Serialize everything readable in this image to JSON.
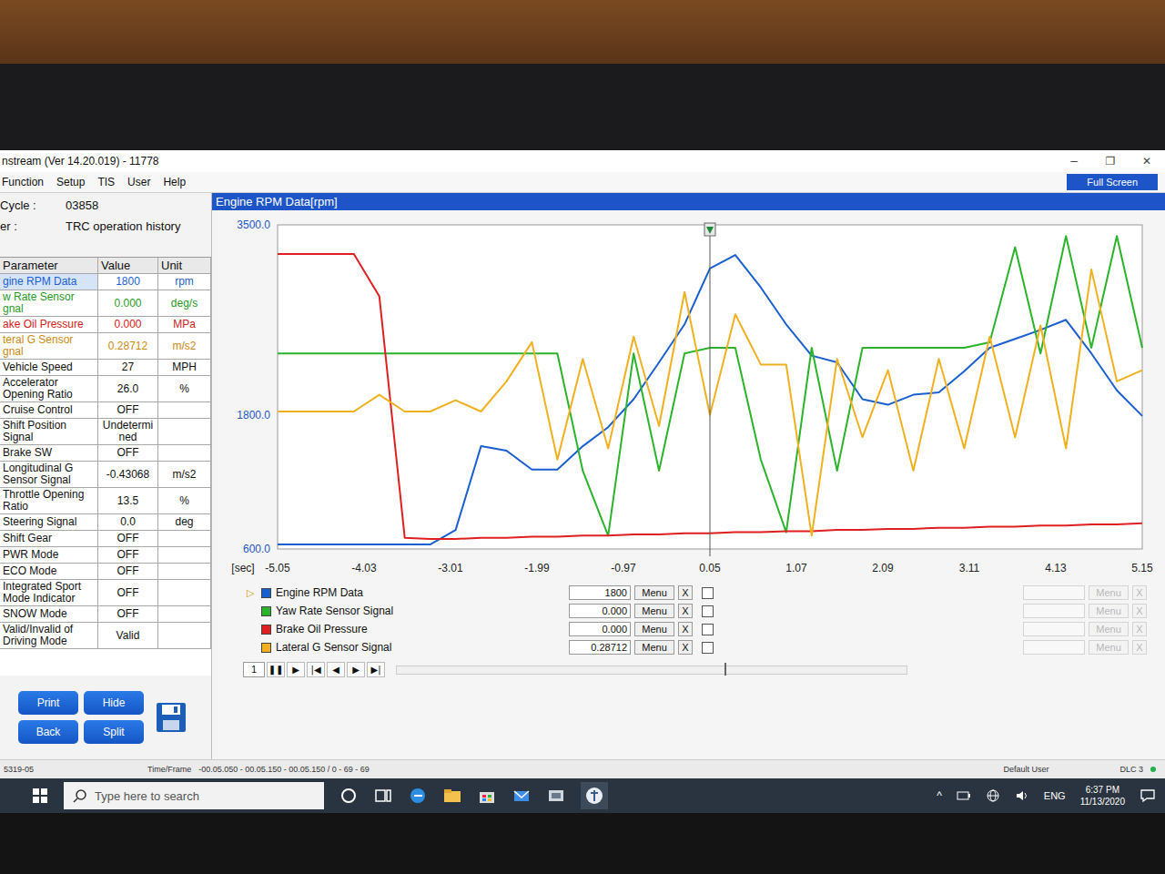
{
  "window": {
    "title": "nstream (Ver 14.20.019) - 11778",
    "controls": [
      "−",
      "❐",
      "✕"
    ]
  },
  "menu": [
    "Function",
    "Setup",
    "TIS",
    "User",
    "Help"
  ],
  "full_screen": "Full Screen",
  "info": [
    {
      "label": "Cycle :",
      "value": "03858"
    },
    {
      "label": "er :",
      "value": "TRC operation history"
    }
  ],
  "table": {
    "columns": [
      "Parameter",
      "Value",
      "Unit"
    ],
    "rows": [
      {
        "parameter": "gine RPM Data",
        "value": "1800",
        "unit": "rpm",
        "color": "#1a5fd0",
        "selected": true
      },
      {
        "parameter": "w Rate Sensor gnal",
        "value": "0.000",
        "unit": "deg/s",
        "color": "#1f9a1f",
        "selected": false
      },
      {
        "parameter": "ake Oil Pressure",
        "value": "0.000",
        "unit": "MPa",
        "color": "#d42020",
        "selected": false
      },
      {
        "parameter": "teral G Sensor gnal",
        "value": "0.28712",
        "unit": "m/s2",
        "color": "#c98a10",
        "selected": false
      },
      {
        "parameter": "Vehicle Speed",
        "value": "27",
        "unit": "MPH",
        "selected": false
      },
      {
        "parameter": "Accelerator Opening Ratio",
        "value": "26.0",
        "unit": "%",
        "selected": false
      },
      {
        "parameter": "Cruise Control",
        "value": "OFF",
        "unit": "",
        "selected": false
      },
      {
        "parameter": "Shift Position Signal",
        "value": "Undetermined",
        "unit": "",
        "selected": false
      },
      {
        "parameter": "Brake SW",
        "value": "OFF",
        "unit": "",
        "selected": false
      },
      {
        "parameter": "Longitudinal G Sensor Signal",
        "value": "-0.43068",
        "unit": "m/s2",
        "selected": false
      },
      {
        "parameter": "Throttle Opening Ratio",
        "value": "13.5",
        "unit": "%",
        "selected": false
      },
      {
        "parameter": "Steering Signal",
        "value": "0.0",
        "unit": "deg",
        "selected": false
      },
      {
        "parameter": "Shift Gear",
        "value": "OFF",
        "unit": "",
        "selected": false
      },
      {
        "parameter": "PWR Mode",
        "value": "OFF",
        "unit": "",
        "selected": false
      },
      {
        "parameter": "ECO Mode",
        "value": "OFF",
        "unit": "",
        "selected": false
      },
      {
        "parameter": "Integrated Sport Mode Indicator",
        "value": "OFF",
        "unit": "",
        "selected": false
      },
      {
        "parameter": "SNOW Mode",
        "value": "OFF",
        "unit": "",
        "selected": false
      },
      {
        "parameter": "Valid/Invalid of Driving Mode",
        "value": "Valid",
        "unit": "",
        "selected": false
      }
    ]
  },
  "buttons": [
    "Print",
    "Hide",
    "Back",
    "Split"
  ],
  "chart": {
    "title": "Engine RPM Data[rpm]",
    "y_min": 600,
    "y_max": 3500,
    "y_ticks": [
      "3500.0",
      "1800.0",
      "600.0"
    ],
    "x_unit": "[sec]",
    "x_ticks": [
      "-5.05",
      "-4.03",
      "-3.01",
      "-1.99",
      "-0.97",
      "0.05",
      "1.07",
      "2.09",
      "3.11",
      "4.13",
      "5.15"
    ],
    "cursor_at": "0.05",
    "series": [
      {
        "name": "Engine RPM Data",
        "color": "#1a5fd0",
        "value": "1800",
        "selected": true,
        "checked": false,
        "values": [
          640,
          640,
          640,
          640,
          640,
          640,
          640,
          770,
          1520,
          1480,
          1310,
          1310,
          1520,
          1690,
          1940,
          2270,
          2610,
          3110,
          3230,
          2940,
          2610,
          2330,
          2270,
          1940,
          1890,
          1980,
          2000,
          2190,
          2400,
          2480,
          2560,
          2650,
          2350,
          2020,
          1790
        ]
      },
      {
        "name": "Yaw Rate Sensor Signal",
        "color": "#2bb32b",
        "value": "0.000",
        "selected": false,
        "checked": false,
        "values": [
          2350,
          2350,
          2350,
          2350,
          2350,
          2350,
          2350,
          2350,
          2350,
          2350,
          2350,
          2350,
          1300,
          720,
          2350,
          1300,
          2350,
          2400,
          2400,
          1400,
          750,
          2400,
          1300,
          2400,
          2400,
          2400,
          2400,
          2400,
          2450,
          3300,
          2350,
          3400,
          2400,
          3400,
          2400
        ]
      },
      {
        "name": "Brake Oil Pressure",
        "color": "#e02020",
        "value": "0.000",
        "selected": false,
        "checked": false,
        "values": [
          3240,
          3240,
          3240,
          3240,
          2860,
          700,
          690,
          690,
          700,
          700,
          710,
          710,
          720,
          720,
          730,
          730,
          740,
          740,
          750,
          750,
          760,
          760,
          770,
          770,
          780,
          780,
          790,
          790,
          800,
          800,
          810,
          810,
          820,
          820,
          830
        ]
      },
      {
        "name": "Lateral G Sensor Signal",
        "color": "#f0b020",
        "value": "0.28712",
        "selected": false,
        "checked": false,
        "values": [
          1830,
          1830,
          1830,
          1830,
          1980,
          1830,
          1830,
          1930,
          1830,
          2100,
          2450,
          1400,
          2300,
          1500,
          2500,
          1700,
          2900,
          1800,
          2700,
          2250,
          2250,
          720,
          2300,
          1600,
          2200,
          1300,
          2300,
          1500,
          2500,
          1600,
          2600,
          1500,
          3100,
          2100,
          2200
        ]
      }
    ],
    "legend_marker": "▷",
    "menu_label": "Menu",
    "close_label": "X",
    "spare_slots": [
      {
        "menu": "Menu",
        "close": "X",
        "disabled": true
      },
      {
        "menu": "Menu",
        "close": "X",
        "disabled": true
      },
      {
        "menu": "Menu",
        "close": "X",
        "disabled": true
      },
      {
        "menu": "Menu",
        "close": "X",
        "disabled": true
      }
    ]
  },
  "player": {
    "frame": "1",
    "controls": [
      "❚❚",
      "▶",
      "|◀",
      "◀",
      "▶",
      "▶|"
    ]
  },
  "status_bar": {
    "code": "5319-05",
    "time_frame_label": "Time/Frame",
    "time_frame": "-00.05.050 - 00.05.150 - 00.05.150 / 0 - 69 - 69",
    "user": "Default User",
    "link": "DLC 3"
  },
  "taskbar": {
    "search_placeholder": "Type here to search",
    "tray_arrow": "^",
    "language": "ENG",
    "time": "6:37 PM",
    "date": "11/13/2020"
  }
}
